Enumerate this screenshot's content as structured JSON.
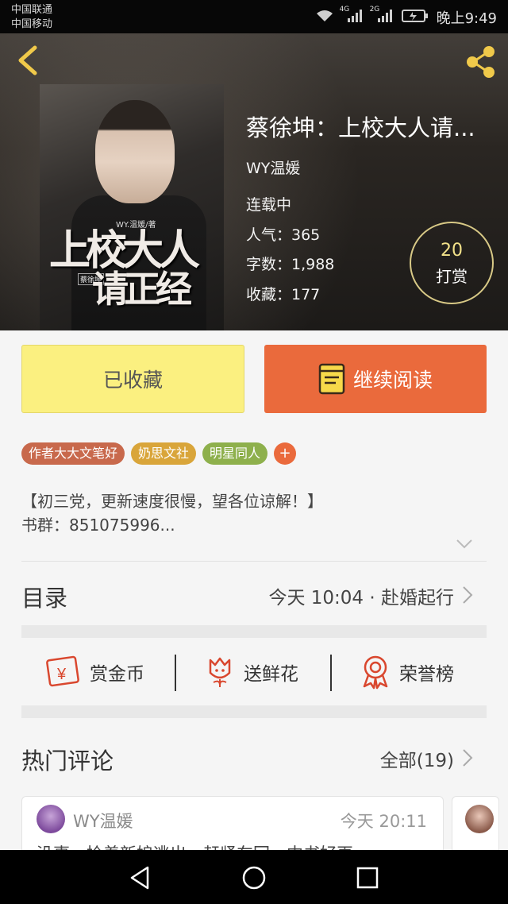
{
  "status_bar": {
    "carrier1": "中国联通",
    "carrier2": "中国移动",
    "network1": "4G",
    "network2": "2G",
    "time": "晚上9:49"
  },
  "book": {
    "title": "蔡徐坤：上校大人请...",
    "author": "WY温媛",
    "status": "连载中",
    "popularity": "人气：365",
    "words": "字数：1,988",
    "favorites": "收藏：177",
    "tip_count": "20",
    "tip_label": "打赏",
    "cover": {
      "author": "WY.温媛/著",
      "title_line1": "上校大人",
      "title_line2": "请正经",
      "subtitle": "蔡徐坤"
    }
  },
  "buttons": {
    "favorited": "已收藏",
    "continue_read": "继续阅读"
  },
  "tags": [
    "作者大大文笔好",
    "奶思文社",
    "明星同人",
    "+"
  ],
  "intro": {
    "line1": "【初三党，更新速度很慢，望各位谅解！】",
    "line2": "书群：851075996..."
  },
  "toc": {
    "title": "目录",
    "latest": "今天 10:04 · 赴婚起行"
  },
  "actions": {
    "coins": "赏金币",
    "flowers": "送鲜花",
    "honor": "荣誉榜"
  },
  "comments": {
    "title": "热门评论",
    "all": "全部(19)",
    "items": [
      {
        "name": "WY温媛",
        "time": "今天 20:11",
        "text": "没事，拎着新娘逃出，赶紧车回，中书好再"
      }
    ]
  },
  "colors": {
    "accent": "#ea6a3c",
    "fav_button": "#fbf080",
    "tip_ring": "#d8c986"
  }
}
